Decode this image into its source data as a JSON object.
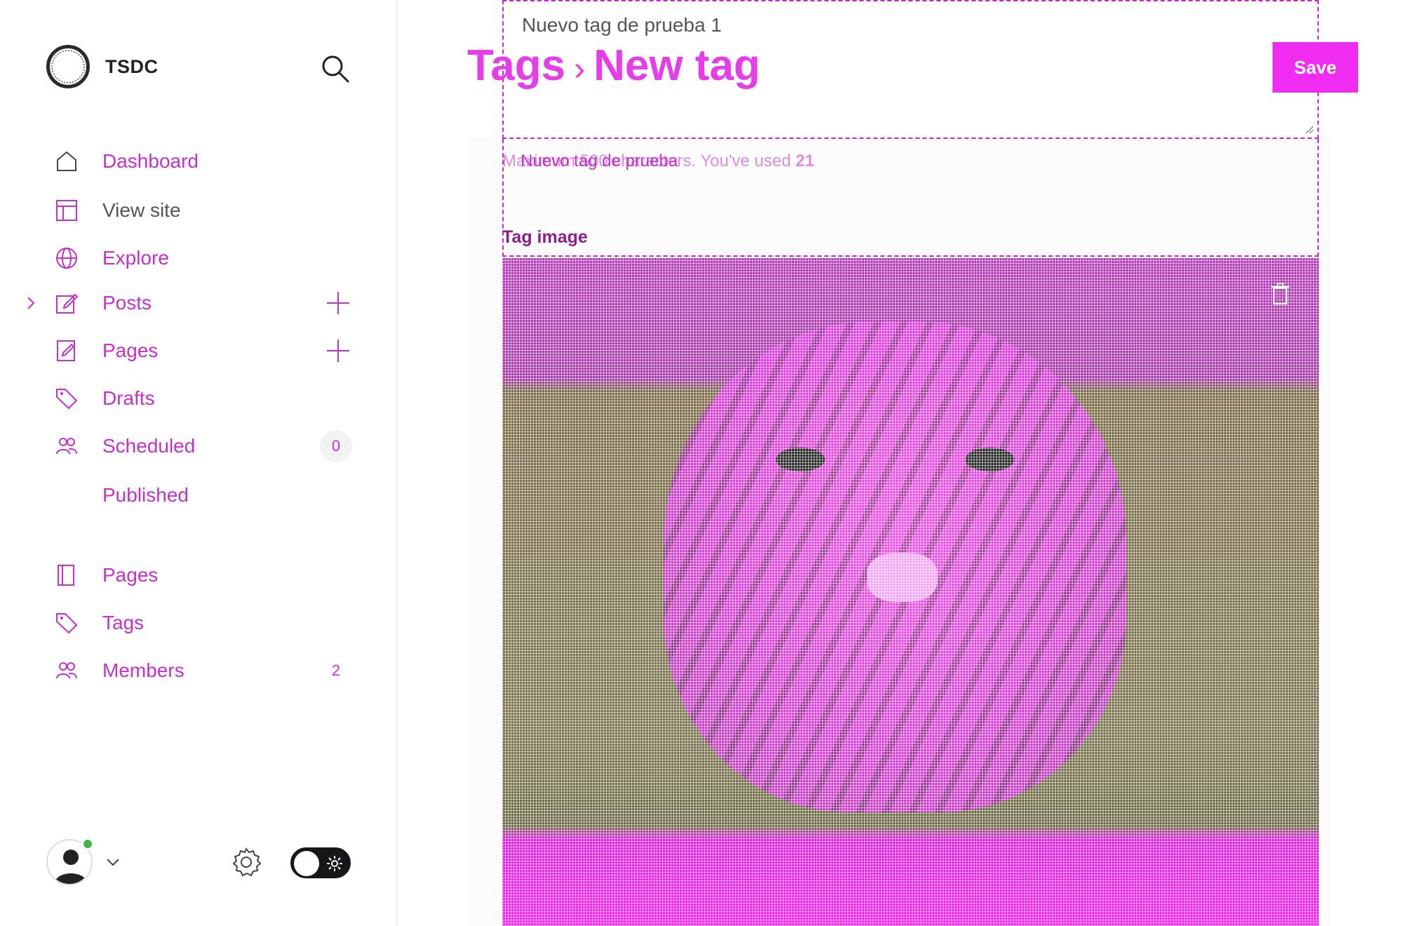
{
  "brand": {
    "name": "TSDC"
  },
  "nav": {
    "items": [
      {
        "label": "Dashboard",
        "icon": "home-icon"
      },
      {
        "label": "View site",
        "icon": "layout-icon"
      },
      {
        "label": "Explore",
        "icon": "globe-icon"
      },
      {
        "label": "Posts",
        "icon": "edit-icon"
      },
      {
        "label": "Pages",
        "icon": "page-edit-icon"
      },
      {
        "label": "Drafts",
        "icon": "tag-icon"
      },
      {
        "label": "Scheduled",
        "icon": "members-icon",
        "count": "0"
      },
      {
        "label": "Published"
      },
      {
        "label": "Pages",
        "icon": "pages-icon"
      },
      {
        "label": "Tags",
        "icon": "tag-icon"
      },
      {
        "label": "Members",
        "icon": "members-icon",
        "count": "2"
      }
    ],
    "ghost_labels": {
      "pages_overlap": "Pages",
      "tags_overlap": "Tags",
      "members_overlap": "Members"
    }
  },
  "header": {
    "breadcrumb_parent": "Tags",
    "breadcrumb_separator": "›",
    "breadcrumb_current": "New tag",
    "save_label": "Save"
  },
  "form": {
    "title_value": "Nuevo tag de prueba 1",
    "description_line": "Nuevo tag de prueba",
    "description_prefix": "Maximum 500 characters. You've used",
    "description_count": "21",
    "tag_image_label": "Tag image"
  },
  "colors": {
    "accent": "#e63ce9",
    "nav_text": "#c62fcb",
    "save_bg": "#f02cf2",
    "status_online": "#3fb63f"
  }
}
